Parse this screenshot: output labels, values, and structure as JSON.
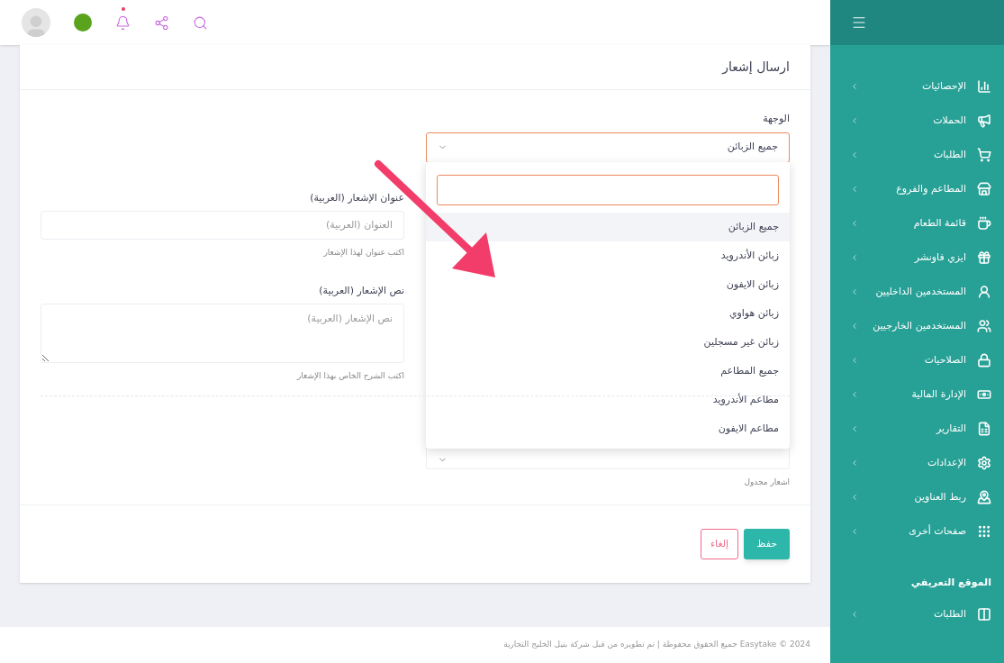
{
  "topbar": {
    "notification_dot": true
  },
  "sidebar": {
    "items": [
      {
        "label": "الإحصائيات"
      },
      {
        "label": "الحملات"
      },
      {
        "label": "الطلبات"
      },
      {
        "label": "المطاعم والفروع"
      },
      {
        "label": "قائمة الطعام"
      },
      {
        "label": "ايزي فاونشر"
      },
      {
        "label": "المستخدمين الداخليين"
      },
      {
        "label": "المستخدمين الخارجيين"
      },
      {
        "label": "الصلاحيات"
      },
      {
        "label": "الإدارة المالية"
      },
      {
        "label": "التقارير"
      },
      {
        "label": "الإعدادات"
      },
      {
        "label": "ربط العناوين"
      },
      {
        "label": "صفحات أخرى"
      }
    ],
    "section_title": "الموقع التعريفي",
    "section_items": [
      {
        "label": "الطلبات"
      }
    ]
  },
  "card": {
    "title": "ارسال إشعار"
  },
  "form": {
    "target": {
      "label": "الوجهة",
      "value": "جميع الزبائن"
    },
    "dropdown": {
      "options": [
        {
          "label": "جميع الزبائن",
          "selected": true
        },
        {
          "label": "زبائن الأندرويد",
          "selected": false
        },
        {
          "label": "زبائن الايفون",
          "selected": false
        },
        {
          "label": "زبائن هواوي",
          "selected": false
        },
        {
          "label": "زبائن غير مسجلين",
          "selected": false
        },
        {
          "label": "جميع المطاعم",
          "selected": false
        },
        {
          "label": "مطاعم الأندرويد",
          "selected": false
        },
        {
          "label": "مطاعم الايفون",
          "selected": false
        }
      ]
    },
    "schedule": {
      "helper": "اشعار مجدول"
    },
    "title_field": {
      "label": "عنوان الإشعار (العربية)",
      "placeholder": "العنوان (العربية)",
      "helper": "اكتب عنوان لهذا الإشعار"
    },
    "body_field": {
      "label": "نص الإشعار (العربية)",
      "placeholder": "نص الإشعار (العربية)",
      "helper": "اكتب الشرح الخاص بهذا الإشعار"
    }
  },
  "buttons": {
    "save": "حفظ",
    "cancel": "إلغاء"
  },
  "footer": "2024 © Easytake جميع الحقوق محفوظة | تم تطويره من قبل شركة بتيل الخليج التجارية"
}
